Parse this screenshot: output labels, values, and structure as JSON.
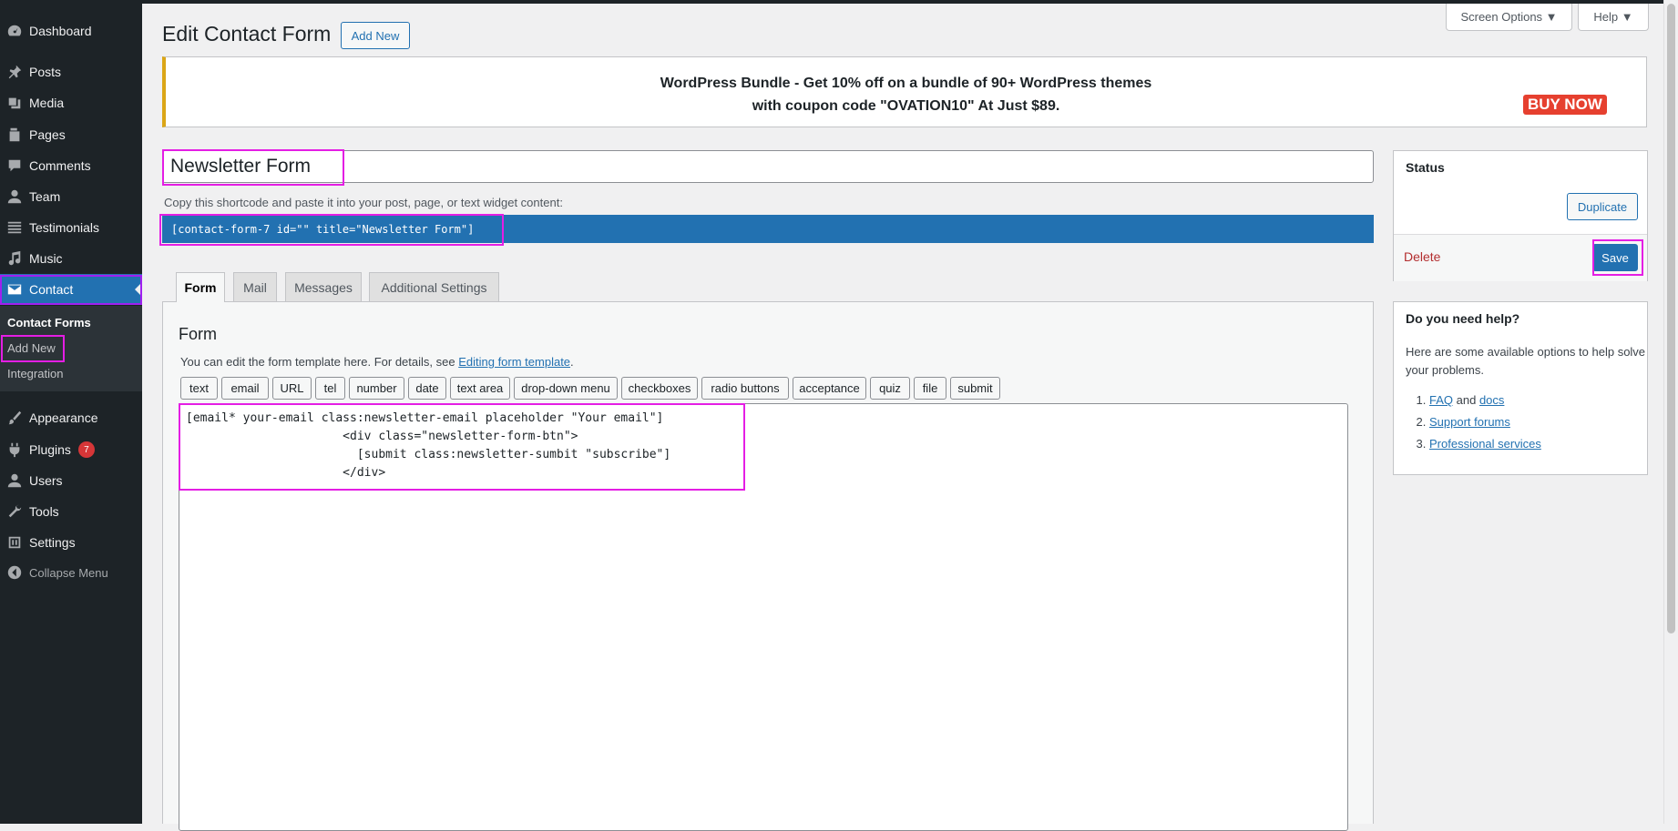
{
  "sidebar": {
    "items": [
      {
        "label": "Dashboard",
        "icon": "dashboard-icon"
      },
      {
        "label": "Posts",
        "icon": "pin-icon"
      },
      {
        "label": "Media",
        "icon": "media-icon"
      },
      {
        "label": "Pages",
        "icon": "pages-icon"
      },
      {
        "label": "Comments",
        "icon": "comment-icon"
      },
      {
        "label": "Team",
        "icon": "user-icon"
      },
      {
        "label": "Testimonials",
        "icon": "list-icon"
      },
      {
        "label": "Music",
        "icon": "music-icon"
      },
      {
        "label": "Contact",
        "icon": "envelope-icon"
      },
      {
        "label": "Appearance",
        "icon": "brush-icon"
      },
      {
        "label": "Plugins",
        "icon": "plugin-icon",
        "badge": "7"
      },
      {
        "label": "Users",
        "icon": "user-icon"
      },
      {
        "label": "Tools",
        "icon": "wrench-icon"
      },
      {
        "label": "Settings",
        "icon": "settings-icon"
      },
      {
        "label": "Collapse Menu",
        "icon": "collapse-icon"
      }
    ],
    "submenu": [
      "Contact Forms",
      "Add New",
      "Integration"
    ]
  },
  "header": {
    "title": "Edit Contact Form",
    "add_new": "Add New",
    "screen_options": "Screen Options ▼",
    "help": "Help ▼"
  },
  "banner": {
    "line1": "WordPress Bundle - Get 10% off on a bundle of 90+ WordPress themes",
    "line2": "with coupon code \"OVATION10\" At Just $89.",
    "buy_now": "BUY NOW"
  },
  "form": {
    "title_value": "Newsletter Form",
    "shortcode_label": "Copy this shortcode and paste it into your post, page, or text widget content:",
    "shortcode": "[contact-form-7 id=\"\" title=\"Newsletter Form\"]"
  },
  "status_box": {
    "title": "Status",
    "duplicate": "Duplicate",
    "delete": "Delete",
    "save": "Save"
  },
  "help_box": {
    "title": "Do you need help?",
    "text": "Here are some available options to help solve your problems.",
    "faq": "FAQ",
    "and": " and ",
    "docs": "docs",
    "support": "Support forums",
    "services": "Professional services"
  },
  "tabs": [
    "Form",
    "Mail",
    "Messages",
    "Additional Settings"
  ],
  "panel": {
    "title": "Form",
    "desc_prefix": "You can edit the form template here. For details, see ",
    "desc_link": "Editing form template",
    "desc_suffix": ".",
    "tag_buttons": [
      "text",
      "email",
      "URL",
      "tel",
      "number",
      "date",
      "text area",
      "drop-down menu",
      "checkboxes",
      "radio buttons",
      "acceptance",
      "quiz",
      "file",
      "submit"
    ],
    "template": "[email* your-email class:newsletter-email placeholder \"Your email\"]\n                      <div class=\"newsletter-form-btn\">\n                        [submit class:newsletter-sumbit \"subscribe\"]\n                      </div>"
  },
  "colors": {
    "admin_bar": "#1d2327",
    "accent": "#2271b1",
    "highlight": "#e41ee4",
    "notice_border": "#dba617",
    "buy_now": "#e6402f"
  }
}
